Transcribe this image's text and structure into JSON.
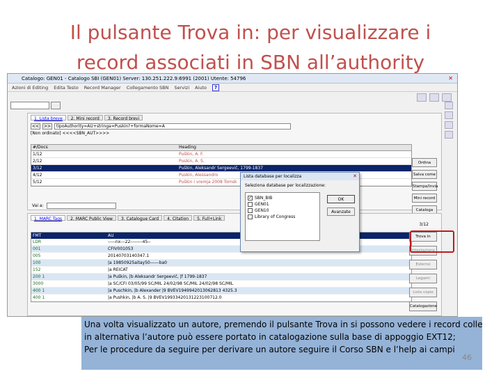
{
  "slide": {
    "title_line1": "Il pulsante Trova in: per visualizzare i",
    "title_line2": "record associati in SBN all’authority",
    "caption_line1": "Una volta visualizzato un autore, premendo il pulsante Trova in si possono vedere i record collegati;",
    "caption_line2": "in alternativa l’autore può essere portato in catalogazione sulla base di appoggio EXT12;",
    "caption_line3": "Per le procedure da seguire per derivare un autore seguire il Corso SBN e l’help ai campi",
    "page_number": "46"
  },
  "window": {
    "title": "Catalogo: GEN01 - Catalogo SBI (GEN01)  Server: 130.251.222.9:6991 (2001)  Utente: 54796",
    "close": "✕"
  },
  "menu": {
    "items": [
      "Azioni di Editing",
      "Edita Testo",
      "Record Manager",
      "Collegamento SBN",
      "Servizi",
      "Aiuto"
    ],
    "help": "?"
  },
  "upper": {
    "tabs": [
      "1. Lista breve",
      "2. Mini record",
      "3. Record brevi"
    ],
    "nav_prev": "<<",
    "nav_next": ">>",
    "query": "tipoAuthority=AU+stringa=Puskin?+formaNome=A",
    "status": "[Non ordinato]   <<<<SBN_AUT>>>>",
    "col_docs": "#/Docs",
    "col_heading": "Heading",
    "rows": [
      {
        "docs": "1/12",
        "heading": "Puškin, A. F."
      },
      {
        "docs": "2/12",
        "heading": "Puskin, A. S."
      },
      {
        "docs": "3/12",
        "heading": "Puškin, Aleksandr Sergeevič, 1799-1837"
      },
      {
        "docs": "4/12",
        "heading": "Puskin, Alessandro"
      },
      {
        "docs": "5/12",
        "heading": "Puškin i vremja 2008 Tomsk"
      }
    ],
    "vai_a_label": "Vai a:",
    "buttons": [
      "Ordina",
      "Salva come",
      "Stampa/Invia",
      "Mini record",
      "Cataloga"
    ]
  },
  "lower": {
    "tabs": [
      "1. MARC Tags",
      "2. MARC Public View",
      "3. Catalogue Card",
      "4. Citation",
      "5. Full+Link"
    ],
    "counter": "3/12",
    "col_fmt": "FMT",
    "col_val": "AU",
    "rows": [
      {
        "fmt": "LDR",
        "val": "-----nx---22--------45--"
      },
      {
        "fmt": "001",
        "val": "CFIV001053"
      },
      {
        "fmt": "005",
        "val": "20140703140347.1"
      },
      {
        "fmt": "100",
        "val": "|a 19850925aitay50------ba0"
      },
      {
        "fmt": "152",
        "val": "|a REICAT"
      },
      {
        "fmt": "200 1",
        "val": "|a Puškin, |b Aleksandr Sergeevič, |f 1799-1837"
      },
      {
        "fmt": "3000",
        "val": "|a SC/CFI 03/05/99 SC/MIL 24/02/98 SC/MIL 24/02/98 SC/MIL"
      },
      {
        "fmt": "400 1",
        "val": "|a Puschkin, |b Alexander |9 BVEV1949942013062813 4325.3"
      },
      {
        "fmt": "400 1",
        "val": "|a Pushkin, |b A. S. |9 BVEV19933420131223100712.0"
      }
    ],
    "buttons": [
      "Trova in",
      "Intestazione",
      "Esterno",
      "Legami",
      "Lista copie",
      "Catalogazione"
    ]
  },
  "dialog": {
    "title": "Lista database per localizza",
    "close": "✕",
    "label": "Seleziona database per localizzazione:",
    "options": [
      {
        "label": "SBN_BIB",
        "checked": "✓"
      },
      {
        "label": "GEN01",
        "checked": ""
      },
      {
        "label": "GEN10",
        "checked": ""
      },
      {
        "label": "Library of Congress",
        "checked": ""
      }
    ],
    "ok": "OK",
    "advanced": "Avanzate"
  }
}
